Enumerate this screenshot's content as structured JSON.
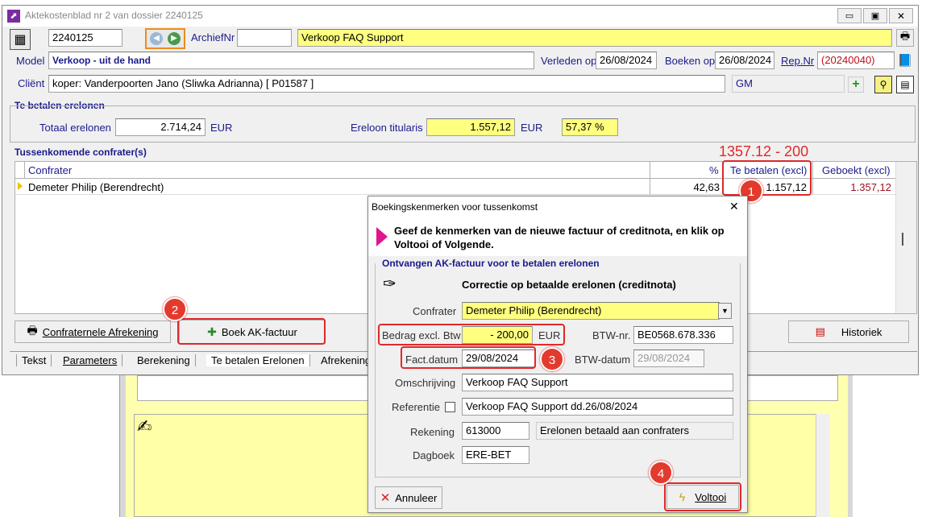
{
  "window": {
    "title": "Aktekostenblad nr 2 van dossier 2240125"
  },
  "header": {
    "dossier_nr": "2240125",
    "archief_label": "ArchiefNr",
    "archief_value": "",
    "subject": "Verkoop FAQ Support",
    "model_label": "Model",
    "model_value": "Verkoop - uit de hand",
    "verleden_label": "Verleden op",
    "verleden_value": "26/08/2024",
    "boeken_label": "Boeken op",
    "boeken_value": "26/08/2024",
    "rep_label": "Rep.Nr",
    "rep_value": "(20240040)",
    "client_label": "Cliënt",
    "client_value": "koper: Vanderpoorten Jano (Sliwka Adrianna) [ P01587 ]",
    "gm_value": "GM"
  },
  "erelonen": {
    "section_title": "Te betalen erelonen",
    "totaal_label": "Totaal erelonen",
    "totaal_value": "2.714,24",
    "totaal_unit": "EUR",
    "titularis_label": "Ereloon titularis",
    "titularis_value": "1.557,12",
    "titularis_unit": "EUR",
    "percent_value": "57,37 %"
  },
  "confraters": {
    "section_title": "Tussenkomende confrater(s)",
    "columns": [
      "Confrater",
      "%",
      "Te betalen (excl)",
      "Geboekt (excl)"
    ],
    "rows": [
      {
        "name": "Demeter Philip (Berendrecht)",
        "pct": "42,63",
        "te_betalen": "1.157,12",
        "geboekt": "1.357,12"
      }
    ],
    "annotation": "1357.12 - 200"
  },
  "bottom_buttons": {
    "afrekening": "Confraternele Afrekening",
    "boek": "Boek AK-factuur",
    "historiek": "Historiek"
  },
  "tabs": [
    "Tekst",
    "Parameters",
    "Berekening",
    "Te betalen Erelonen",
    "Afrekening"
  ],
  "dialog": {
    "title": "Boekingskenmerken voor tussenkomst",
    "instruction": "Geef de kenmerken van de nieuwe factuur of creditnota, en klik op Voltooi of Volgende.",
    "group_title": "Ontvangen AK-factuur voor te betalen erelonen",
    "heading": "Correctie op betaalde erelonen (creditnota)",
    "confrater_label": "Confrater",
    "confrater_value": "Demeter Philip (Berendrecht)",
    "bedrag_label": "Bedrag excl. Btw",
    "bedrag_value": "- 200,00",
    "bedrag_unit": "EUR",
    "btwnr_label": "BTW-nr.",
    "btwnr_value": "BE0568.678.336",
    "factdatum_label": "Fact.datum",
    "factdatum_value": "29/08/2024",
    "btwdatum_label": "BTW-datum",
    "btwdatum_value": "29/08/2024",
    "omschrijving_label": "Omschrijving",
    "omschrijving_value": "Verkoop FAQ Support",
    "referentie_label": "Referentie",
    "referentie_value": "Verkoop FAQ Support dd.26/08/2024",
    "rekening_label": "Rekening",
    "rekening_value": "613000",
    "rekening_desc": "Erelonen betaald aan confraters",
    "dagboek_label": "Dagboek",
    "dagboek_value": "ERE-BET",
    "annuleer_label": "Annuleer",
    "voltooi_label": "Voltooi"
  },
  "badges": [
    "1",
    "2",
    "3",
    "4"
  ],
  "colors": {
    "accent_red": "#e0282a",
    "label_blue": "#1a1a8c",
    "field_yellow": "#ffff80"
  }
}
